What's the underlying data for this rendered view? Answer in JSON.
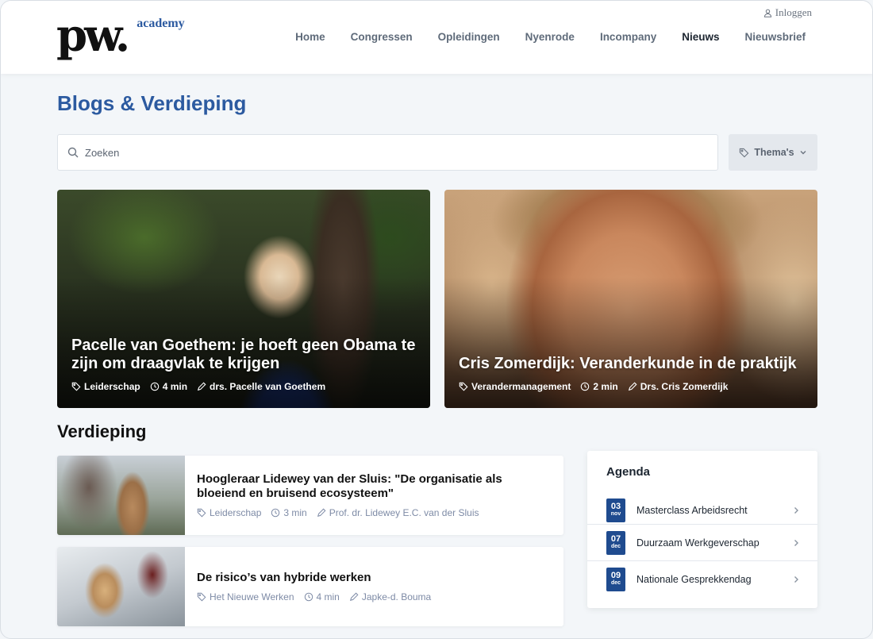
{
  "header": {
    "logo_mark": "pw.",
    "logo_sub": "academy",
    "login_label": "Inloggen",
    "nav": [
      "Home",
      "Congressen",
      "Opleidingen",
      "Nyenrode",
      "Incompany",
      "Nieuws",
      "Nieuwsbrief"
    ],
    "active_nav": "Nieuws"
  },
  "page": {
    "title": "Blogs & Verdieping",
    "search_placeholder": "Zoeken",
    "themes_label": "Thema's"
  },
  "featured": [
    {
      "title": "Pacelle van Goethem: je hoeft geen Obama te zijn om draagvlak te krijgen",
      "tag": "Leiderschap",
      "time": "4 min",
      "author": "drs. Pacelle van Goethem"
    },
    {
      "title": "Cris Zomerdijk: Veranderkunde in de praktijk",
      "tag": "Verandermanagement",
      "time": "2 min",
      "author": "Drs. Cris Zomerdijk"
    }
  ],
  "section": {
    "title": "Verdieping"
  },
  "articles": [
    {
      "title": "Hoogleraar Lidewey van der Sluis: \"De organisatie als bloeiend en bruisend ecosysteem\"",
      "tag": "Leiderschap",
      "time": "3 min",
      "author": "Prof. dr. Lidewey E.C. van der Sluis"
    },
    {
      "title": "De risico’s van hybride werken",
      "tag": "Het Nieuwe Werken",
      "time": "4 min",
      "author": "Japke-d. Bouma"
    }
  ],
  "agenda": {
    "title": "Agenda",
    "items": [
      {
        "day": "03",
        "month": "nov",
        "label": "Masterclass Arbeidsrecht"
      },
      {
        "day": "07",
        "month": "dec",
        "label": "Duurzaam Werkgeverschap"
      },
      {
        "day": "09",
        "month": "dec",
        "label": "Nationale Gesprekkendag"
      }
    ]
  },
  "colors": {
    "brand_blue": "#2c5aa0",
    "date_badge": "#1f4b8f",
    "meta_blue": "#7e8ba6"
  }
}
